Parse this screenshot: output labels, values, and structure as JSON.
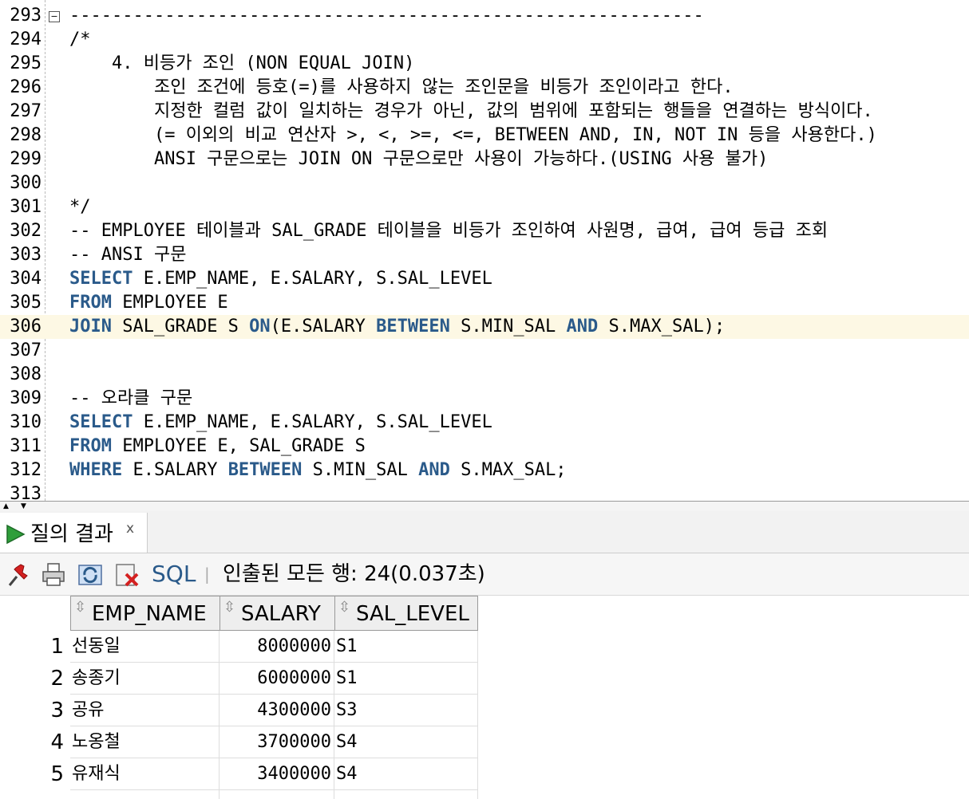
{
  "editor": {
    "highlight_line": 306,
    "lines": [
      {
        "n": "293",
        "segs": [
          {
            "t": "------------------------------------------------------------",
            "c": "cmt"
          }
        ]
      },
      {
        "n": "294",
        "segs": [
          {
            "t": "/*",
            "c": "cmt"
          }
        ]
      },
      {
        "n": "295",
        "segs": [
          {
            "t": "    4. 비등가 조인 (NON EQUAL JOIN)",
            "c": "cmt"
          }
        ]
      },
      {
        "n": "296",
        "segs": [
          {
            "t": "        조인 조건에 등호(=)를 사용하지 않는 조인문을 비등가 조인이라고 한다.",
            "c": "cmt"
          }
        ]
      },
      {
        "n": "297",
        "segs": [
          {
            "t": "        지정한 컬럼 값이 일치하는 경우가 아닌, 값의 범위에 포함되는 행들을 연결하는 방식이다.",
            "c": "cmt"
          }
        ]
      },
      {
        "n": "298",
        "segs": [
          {
            "t": "        (= 이외의 비교 연산자 >, <, >=, <=, BETWEEN AND, IN, NOT IN 등을 사용한다.)",
            "c": "cmt"
          }
        ]
      },
      {
        "n": "299",
        "segs": [
          {
            "t": "        ANSI 구문으로는 JOIN ON 구문으로만 사용이 가능하다.(USING 사용 불가)",
            "c": "cmt"
          }
        ]
      },
      {
        "n": "300",
        "segs": []
      },
      {
        "n": "301",
        "segs": [
          {
            "t": "*/",
            "c": "cmt"
          }
        ]
      },
      {
        "n": "302",
        "segs": [
          {
            "t": "-- EMPLOYEE 테이블과 SAL_GRADE 테이블을 비등가 조인하여 사원명, 급여, 급여 등급 조회",
            "c": "cmt"
          }
        ]
      },
      {
        "n": "303",
        "segs": [
          {
            "t": "-- ANSI 구문",
            "c": "cmt"
          }
        ]
      },
      {
        "n": "304",
        "segs": [
          {
            "t": "SELECT",
            "c": "kw"
          },
          {
            "t": " E.EMP_NAME, E.SALARY, S.SAL_LEVEL",
            "c": ""
          }
        ]
      },
      {
        "n": "305",
        "segs": [
          {
            "t": "FROM",
            "c": "kw"
          },
          {
            "t": " EMPLOYEE E",
            "c": ""
          }
        ]
      },
      {
        "n": "306",
        "segs": [
          {
            "t": "JOIN",
            "c": "kw"
          },
          {
            "t": " SAL_GRADE S ",
            "c": ""
          },
          {
            "t": "ON",
            "c": "kw"
          },
          {
            "t": "(E.SALARY ",
            "c": ""
          },
          {
            "t": "BETWEEN",
            "c": "kw"
          },
          {
            "t": " S.MIN_SAL ",
            "c": ""
          },
          {
            "t": "AND",
            "c": "kw"
          },
          {
            "t": " S.MAX_SAL);",
            "c": ""
          }
        ]
      },
      {
        "n": "307",
        "segs": []
      },
      {
        "n": "308",
        "segs": []
      },
      {
        "n": "309",
        "segs": [
          {
            "t": "-- 오라클 구문",
            "c": "cmt"
          }
        ]
      },
      {
        "n": "310",
        "segs": [
          {
            "t": "SELECT",
            "c": "kw"
          },
          {
            "t": " E.EMP_NAME, E.SALARY, S.SAL_LEVEL",
            "c": ""
          }
        ]
      },
      {
        "n": "311",
        "segs": [
          {
            "t": "FROM",
            "c": "kw"
          },
          {
            "t": " EMPLOYEE E, SAL_GRADE S",
            "c": ""
          }
        ]
      },
      {
        "n": "312",
        "segs": [
          {
            "t": "WHERE",
            "c": "kw"
          },
          {
            "t": " E.SALARY ",
            "c": ""
          },
          {
            "t": "BETWEEN",
            "c": "kw"
          },
          {
            "t": " S.MIN_SAL ",
            "c": ""
          },
          {
            "t": "AND",
            "c": "kw"
          },
          {
            "t": " S.MAX_SAL;",
            "c": ""
          }
        ]
      },
      {
        "n": "313",
        "segs": []
      }
    ]
  },
  "results_tab": {
    "label": "질의 결과",
    "close": "x"
  },
  "toolbar": {
    "sql_label": "SQL",
    "separator": "|",
    "status": "인출된 모든 행: 24(0.037초)"
  },
  "grid": {
    "columns": [
      "EMP_NAME",
      "SALARY",
      "SAL_LEVEL"
    ],
    "rows": [
      {
        "num": "1",
        "name": "선동일",
        "salary": "8000000",
        "level": "S1"
      },
      {
        "num": "2",
        "name": "송종기",
        "salary": "6000000",
        "level": "S1"
      },
      {
        "num": "3",
        "name": "공유",
        "salary": "4300000",
        "level": "S3"
      },
      {
        "num": "4",
        "name": "노옹철",
        "salary": "3700000",
        "level": "S4"
      },
      {
        "num": "5",
        "name": "유재식",
        "salary": "3400000",
        "level": "S4"
      }
    ]
  },
  "colors": {
    "keyword": "#2a5a8a",
    "comment": "#737373",
    "highlight_bg": "#fdf8e4",
    "run_icon": "#2e9e3a"
  }
}
